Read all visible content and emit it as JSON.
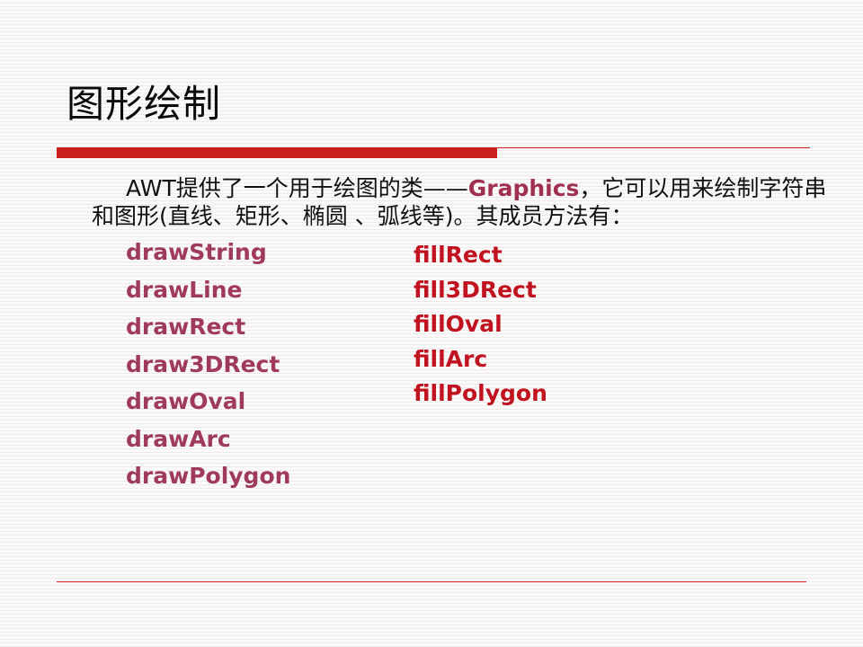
{
  "slide": {
    "title": "图形绘制",
    "intro": {
      "before": "AWT提供了一个用于绘图的类——",
      "keyword": "Graphics",
      "after": "，它可以用来绘制字符串和图形(直线、矩形、椭圆 、弧线等)。其成员方法有："
    },
    "draw_methods": [
      "drawString",
      "drawLine",
      "drawRect",
      "draw3DRect",
      "drawOval",
      "drawArc",
      "drawPolygon"
    ],
    "fill_methods": [
      "fillRect",
      "fill3DRect",
      "fillOval",
      "fillArc",
      "fillPolygon"
    ],
    "colors": {
      "accent": "#cc1f1f",
      "draw_method_color": "#a03a5a",
      "fill_method_color": "#c1121f",
      "keyword_color": "#a03050"
    }
  }
}
